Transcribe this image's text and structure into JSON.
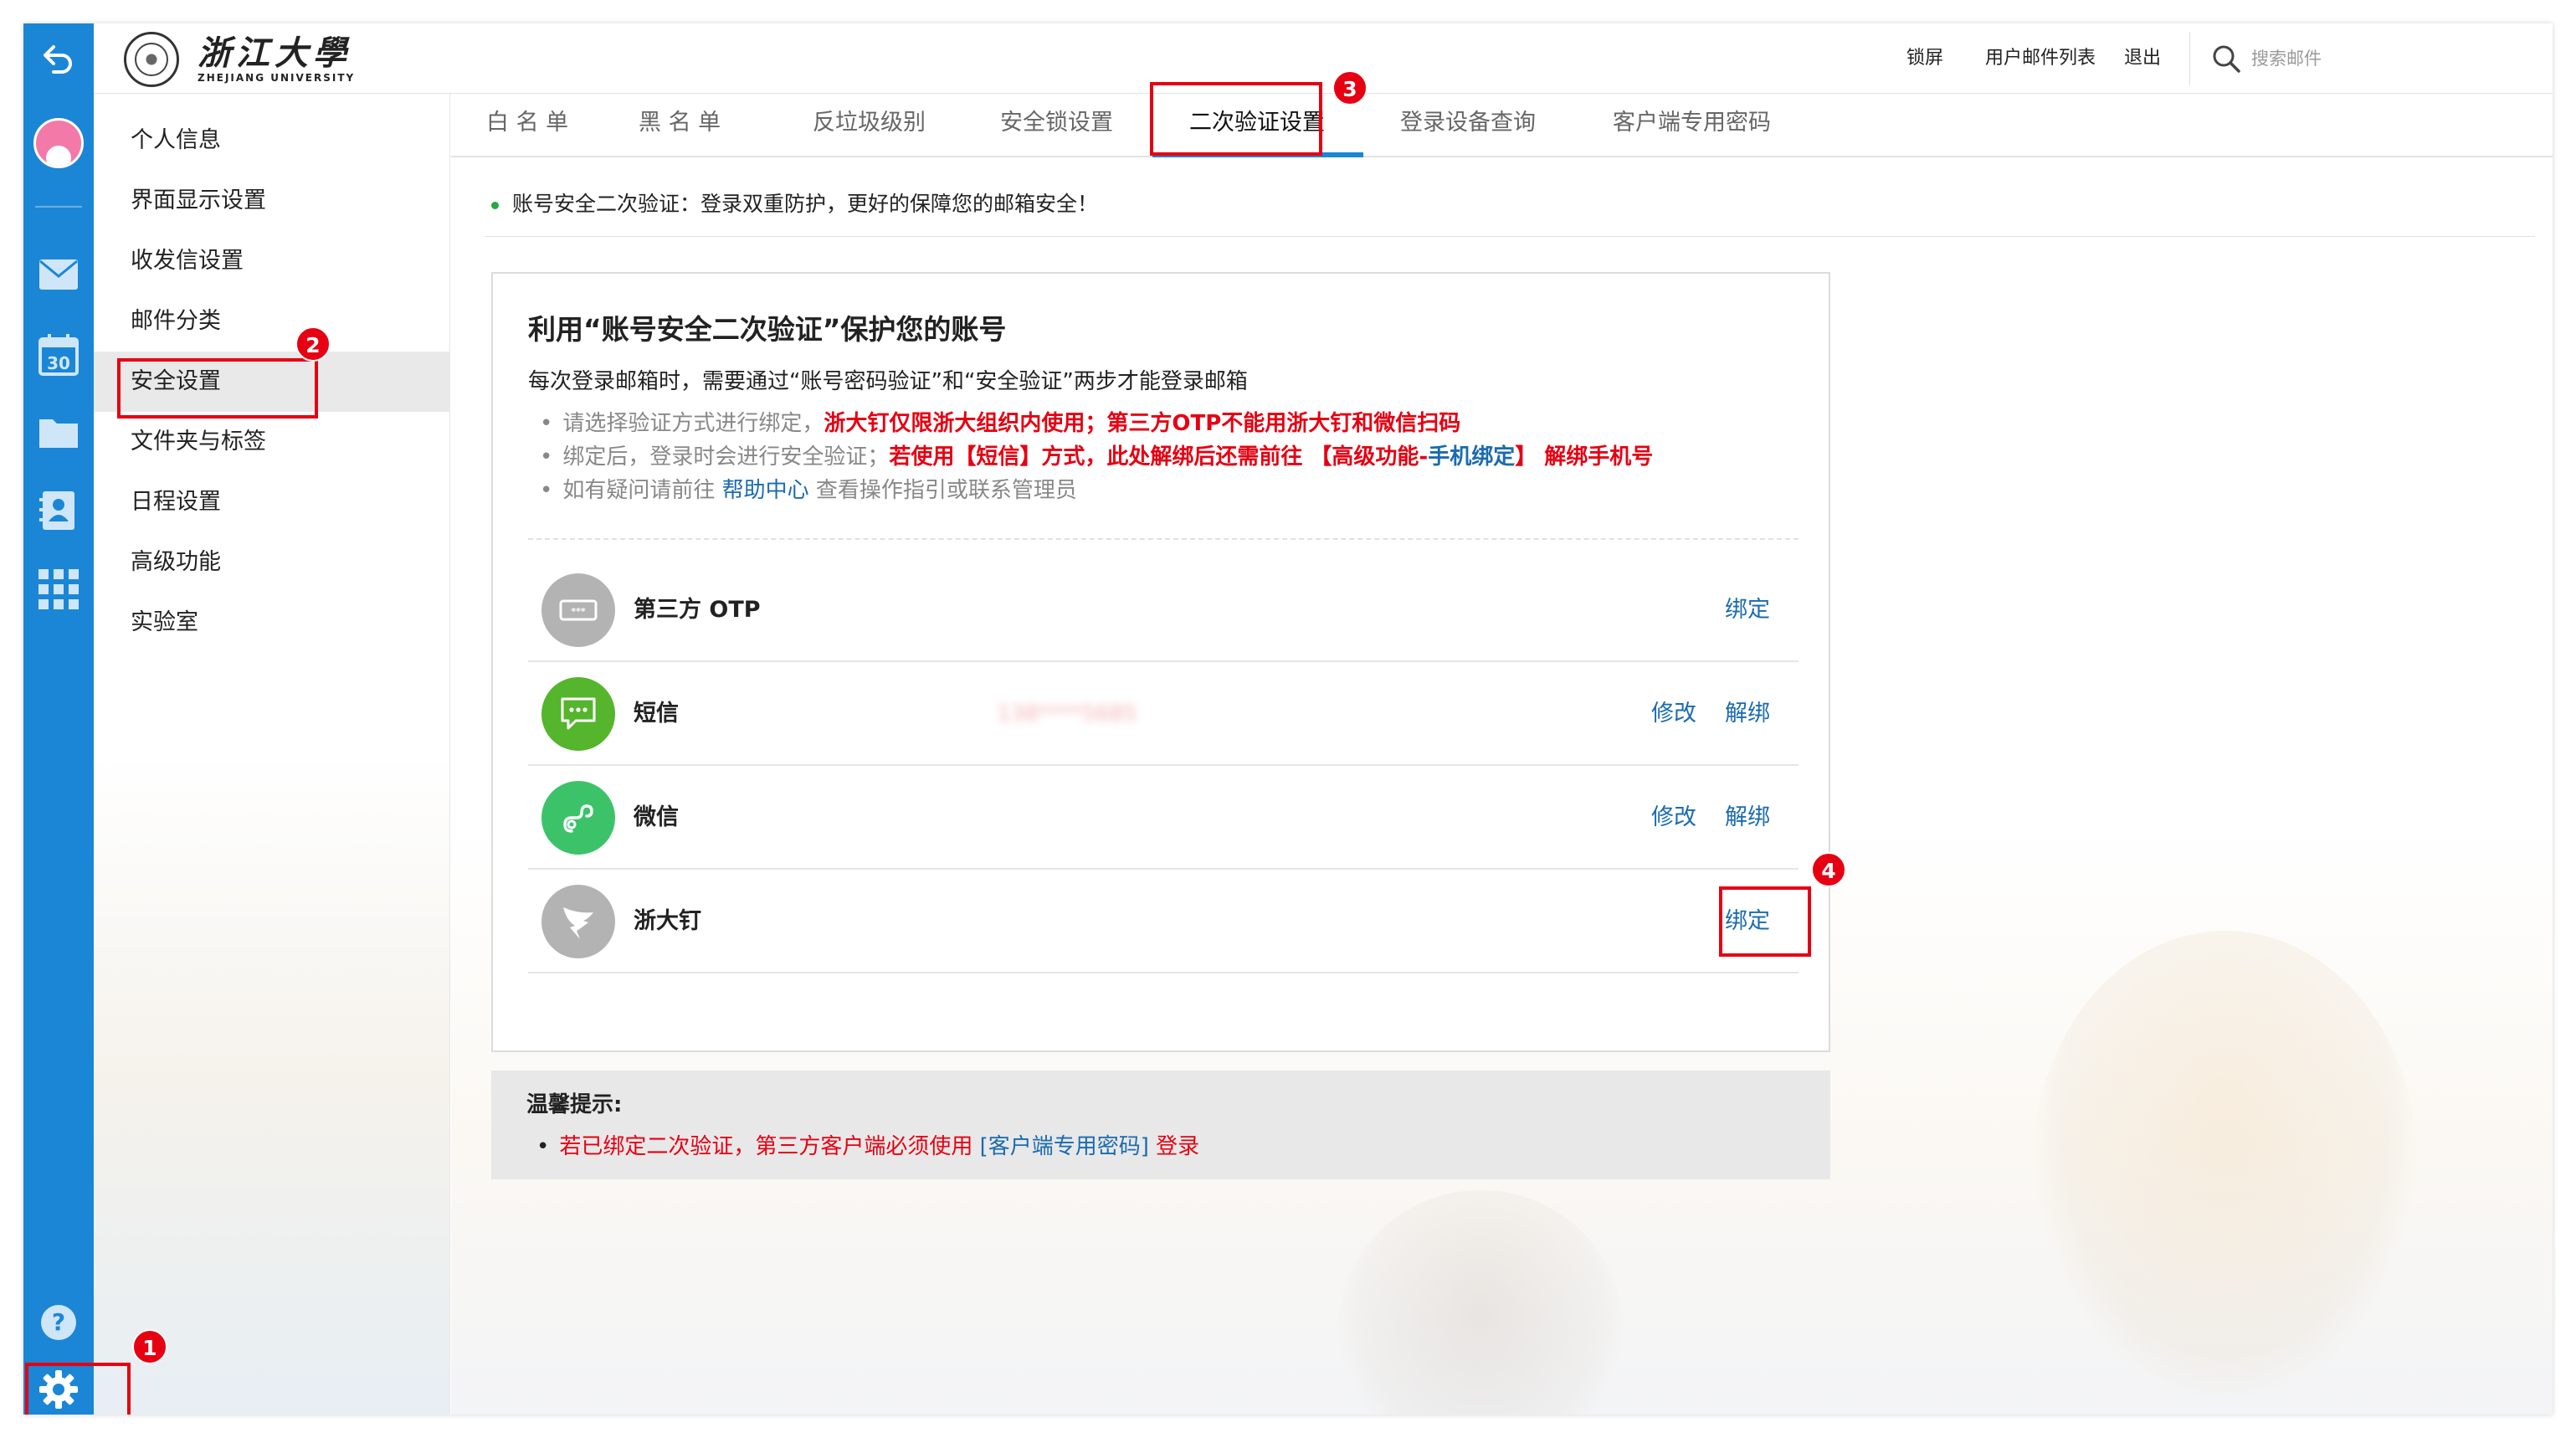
{
  "logo": {
    "cn": "浙江大學",
    "en": "ZHEJIANG UNIVERSITY"
  },
  "header": {
    "lock_screen": "锁屏",
    "mail_list": "用户邮件列表",
    "logout": "退出",
    "search_placeholder": "搜索邮件"
  },
  "sidebar": {
    "items": [
      {
        "label": "个人信息"
      },
      {
        "label": "界面显示设置"
      },
      {
        "label": "收发信设置"
      },
      {
        "label": "邮件分类"
      },
      {
        "label": "安全设置",
        "active": true
      },
      {
        "label": "文件夹与标签"
      },
      {
        "label": "日程设置"
      },
      {
        "label": "高级功能"
      },
      {
        "label": "实验室"
      }
    ]
  },
  "tabs": [
    {
      "label": "白 名 单"
    },
    {
      "label": "黑 名 单"
    },
    {
      "label": "反垃圾级别"
    },
    {
      "label": "安全锁设置"
    },
    {
      "label": "二次验证设置",
      "active": true
    },
    {
      "label": "登录设备查询"
    },
    {
      "label": "客户端专用密码"
    }
  ],
  "notice": "账号安全二次验证：登录双重防护，更好的保障您的邮箱安全！",
  "card": {
    "title": "利用“账号安全二次验证”保护您的账号",
    "desc": "每次登录邮箱时，需要通过“账号密码验证”和“安全验证”两步才能登录邮箱",
    "bullet1_gray": "请选择验证方式进行绑定，",
    "bullet1_red": "浙大钉仅限浙大组织内使用；第三方OTP不能用浙大钉和微信扫码",
    "bullet2_gray": "绑定后，登录时会进行安全验证；",
    "bullet2_red_a": "若使用【短信】方式，此处解绑后还需前往 【高级功能-",
    "bullet2_blue": "手机绑定",
    "bullet2_red_b": "】 解绑手机号",
    "bullet3_gray_a": "如有疑问请前往 ",
    "bullet3_blue": "帮助中心",
    "bullet3_gray_b": " 查看操作指引或联系管理员",
    "bullet_mark": "•"
  },
  "methods": [
    {
      "name": "第三方 OTP",
      "icon": "otp-icon",
      "color": "#b3b3b3",
      "actions": [
        "绑定"
      ]
    },
    {
      "name": "短信",
      "icon": "sms-icon",
      "color": "#55b52c",
      "value": "138****5685",
      "actions": [
        "修改",
        "解绑"
      ]
    },
    {
      "name": "微信",
      "icon": "wechat-icon",
      "color": "#3cc36a",
      "actions": [
        "修改",
        "解绑"
      ]
    },
    {
      "name": "浙大钉",
      "icon": "dingtalk-icon",
      "color": "#b3b3b3",
      "actions": [
        "绑定"
      ]
    }
  ],
  "tips": {
    "title": "温馨提示:",
    "text_a": "若已绑定二次验证，第三方客户端必须使用 ",
    "link": "[客户端专用密码]",
    "text_b": " 登录",
    "mark": "•"
  },
  "annotations": {
    "step1": "1",
    "step2": "2",
    "step3": "3",
    "step4": "4"
  },
  "colors": {
    "brand_blue": "#1b86d6",
    "link_blue": "#1a6bb0",
    "alert_red": "#e60012"
  }
}
